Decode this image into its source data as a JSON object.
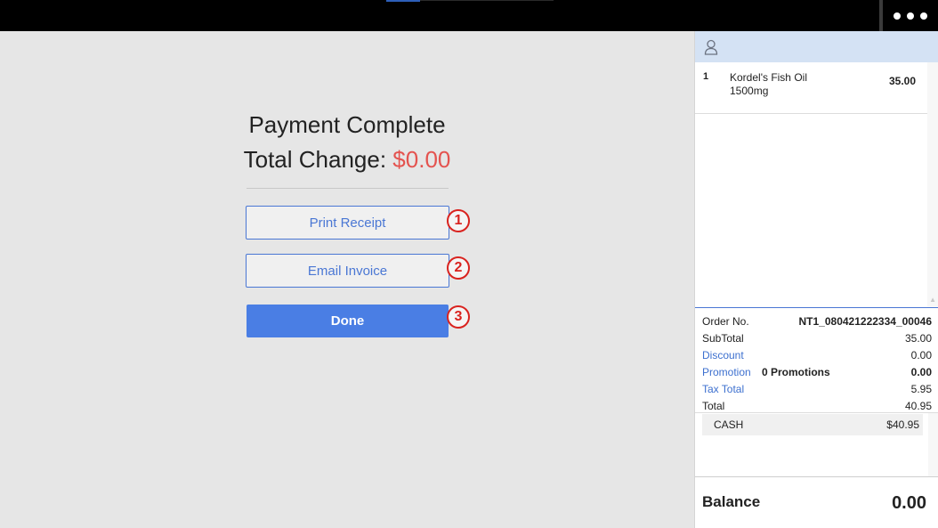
{
  "topbar": {
    "more_icon": "more-horizontal-icon"
  },
  "payment": {
    "title": "Payment Complete",
    "change_label": "Total Change:",
    "change_amount": "$0.00",
    "change_color": "#e4534f"
  },
  "actions": {
    "print_label": "Print Receipt",
    "email_label": "Email Invoice",
    "done_label": "Done"
  },
  "badges": [
    "1",
    "2",
    "3"
  ],
  "cart": {
    "customer_icon": "user-icon",
    "items": [
      {
        "qty": "1",
        "name": "Kordel's Fish Oil 1500mg",
        "price": "35.00"
      }
    ]
  },
  "totals": {
    "order_label": "Order No.",
    "order_value": "NT1_080421222334_00046",
    "subtotal_label": "SubTotal",
    "subtotal_value": "35.00",
    "discount_label": "Discount",
    "discount_value": "0.00",
    "promotion_label": "Promotion",
    "promotion_count": "0 Promotions",
    "promotion_value": "0.00",
    "tax_label": "Tax Total",
    "tax_value": "5.95",
    "total_label": "Total",
    "total_value": "40.95"
  },
  "payments": [
    {
      "method": "CASH",
      "amount": "$40.95"
    }
  ],
  "balance": {
    "label": "Balance",
    "value": "0.00"
  },
  "colors": {
    "accent": "#4a7ee4",
    "badge": "#d9231f",
    "header_bg": "#d4e2f4"
  }
}
